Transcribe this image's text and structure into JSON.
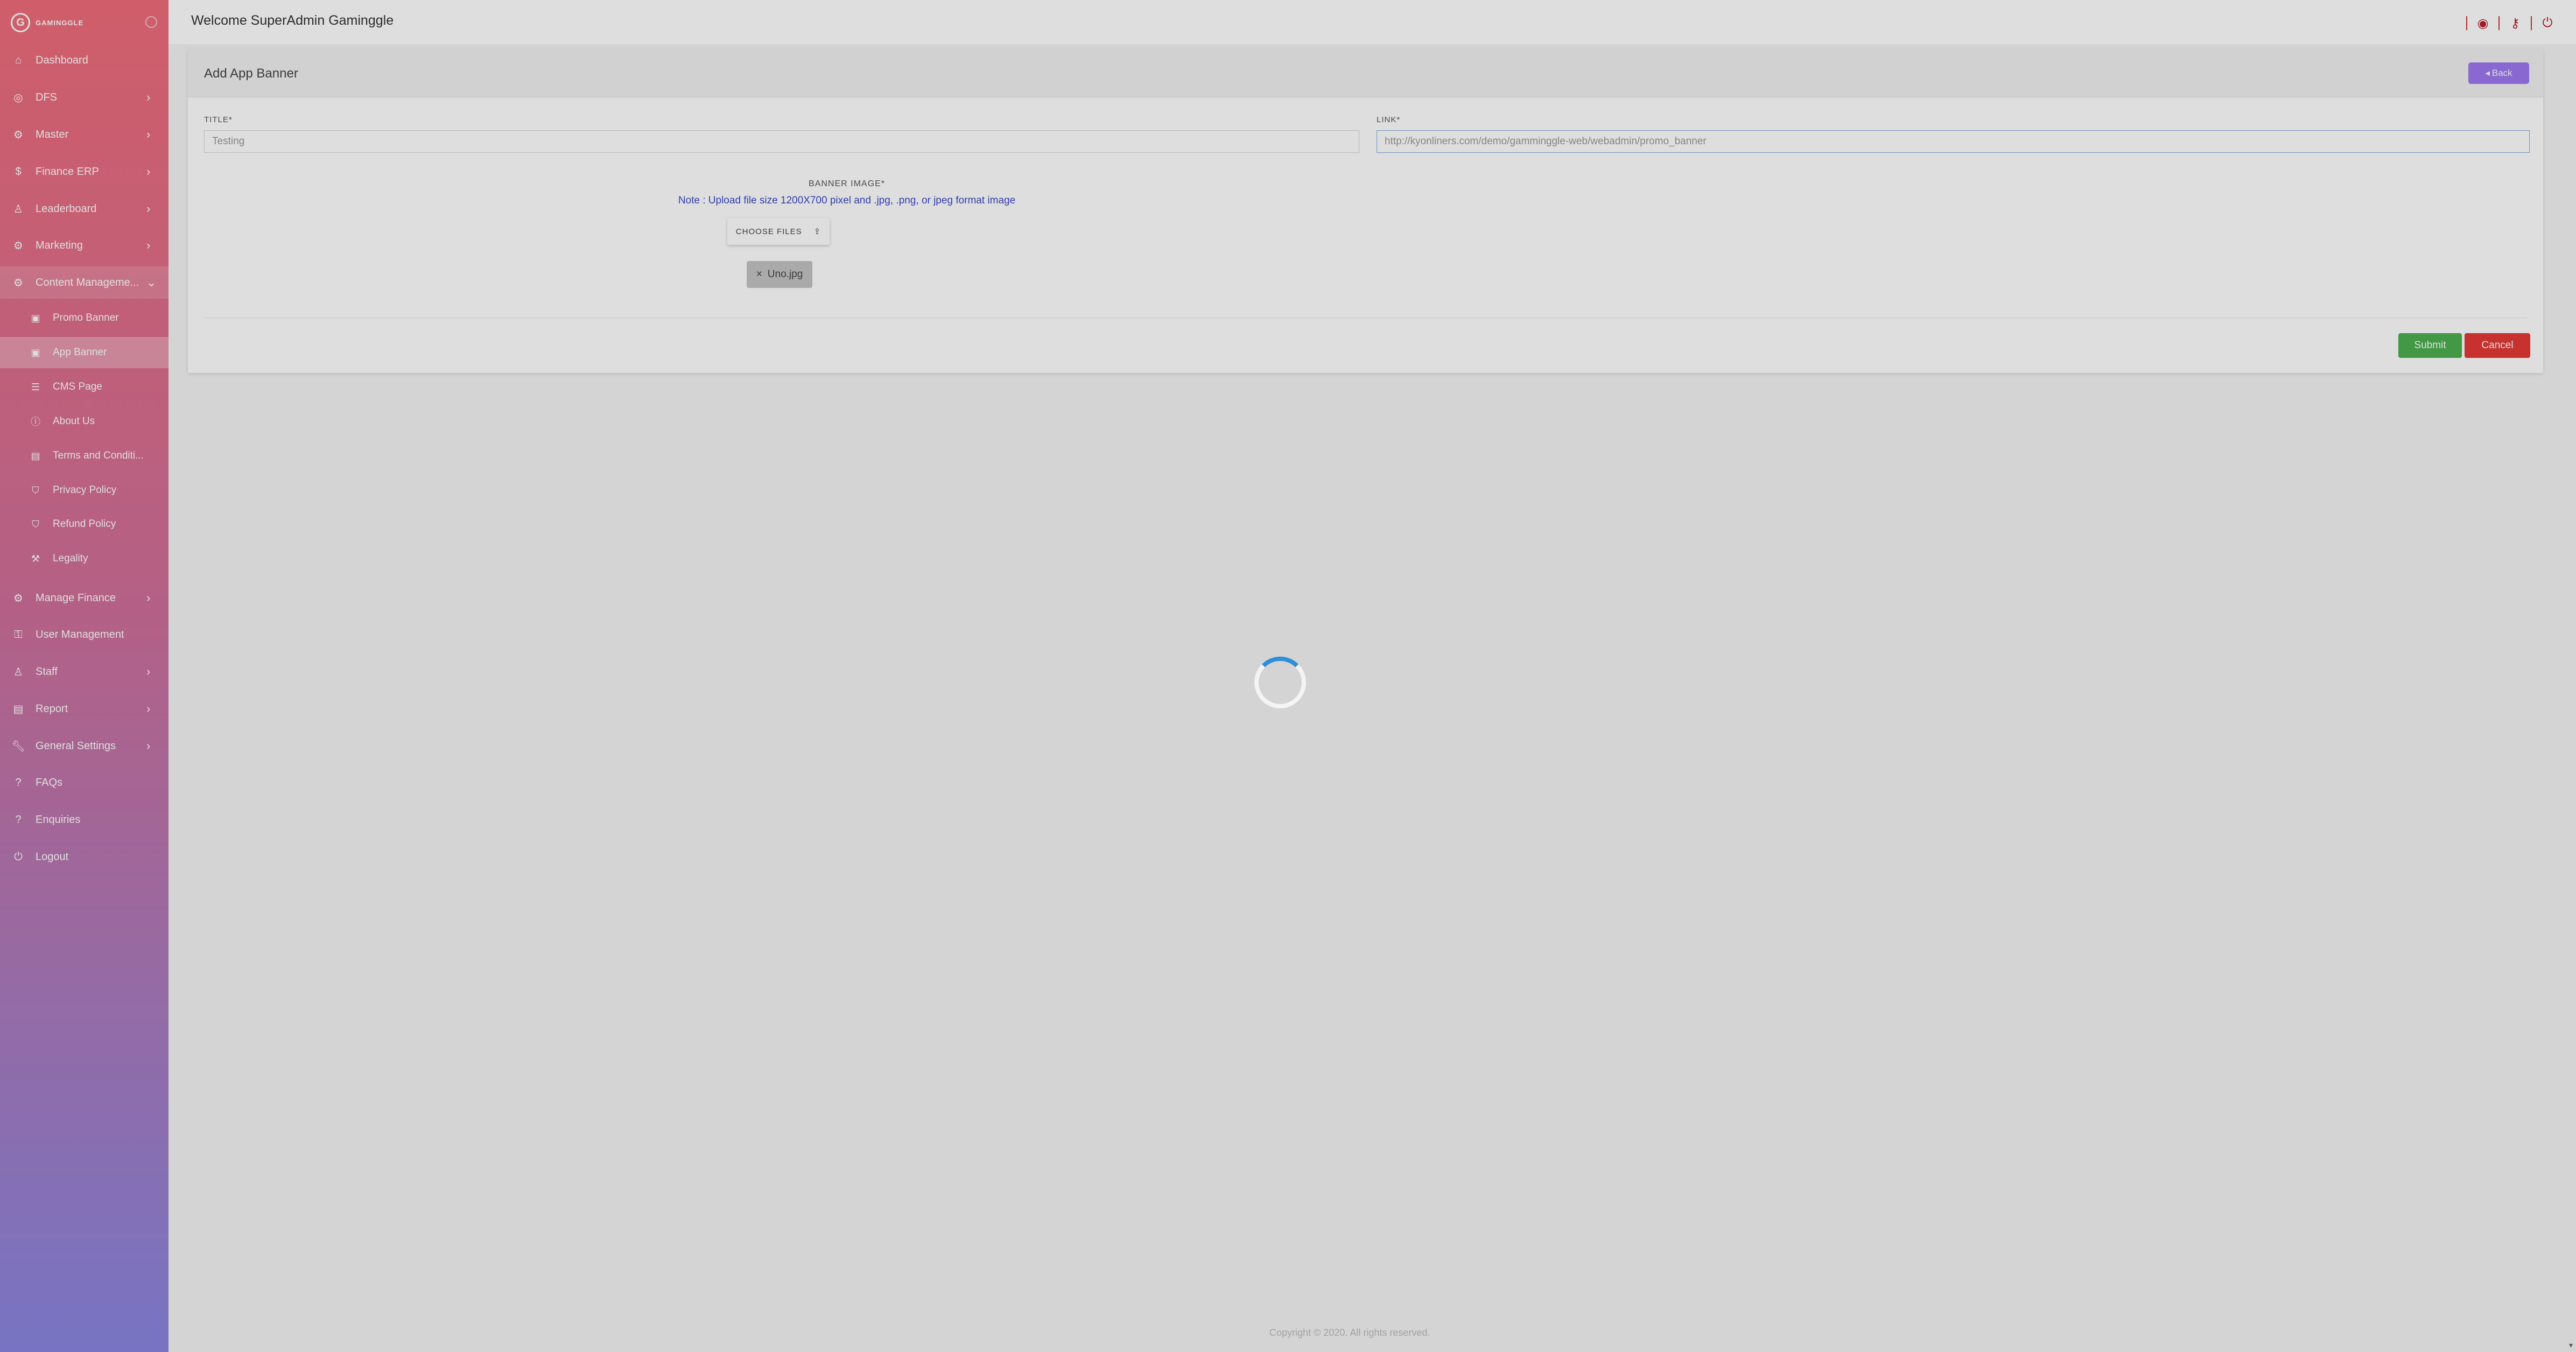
{
  "brand": {
    "logo_glyph": "G",
    "name": "GAMINGGLE"
  },
  "header": {
    "welcome": "Welcome SuperAdmin Gaminggle"
  },
  "sidebar": {
    "items": [
      {
        "label": "Dashboard",
        "icon": "home-icon"
      },
      {
        "label": "DFS",
        "icon": "target-icon",
        "chevron": "›"
      },
      {
        "label": "Master",
        "icon": "gears-icon",
        "chevron": "›"
      },
      {
        "label": "Finance ERP",
        "icon": "dollar-icon",
        "chevron": "›"
      },
      {
        "label": "Leaderboard",
        "icon": "user-icon",
        "chevron": "›"
      },
      {
        "label": "Marketing",
        "icon": "gears-icon",
        "chevron": "›"
      },
      {
        "label": "Content Manageme...",
        "icon": "gears-icon",
        "chevron": "⌄"
      },
      {
        "label": "Manage Finance",
        "icon": "gears-icon",
        "chevron": "›"
      },
      {
        "label": "User Management",
        "icon": "lock-icon"
      },
      {
        "label": "Staff",
        "icon": "user-icon",
        "chevron": "›"
      },
      {
        "label": "Report",
        "icon": "document-icon",
        "chevron": "›"
      },
      {
        "label": "General Settings",
        "icon": "wrench-icon",
        "chevron": "›"
      },
      {
        "label": "FAQs",
        "icon": "question-icon"
      },
      {
        "label": "Enquiries",
        "icon": "question-icon"
      },
      {
        "label": "Logout",
        "icon": "power-icon"
      }
    ],
    "sub_items": [
      {
        "label": "Promo Banner",
        "icon": "image-icon"
      },
      {
        "label": "App Banner",
        "icon": "image-icon"
      },
      {
        "label": "CMS Page",
        "icon": "list-icon"
      },
      {
        "label": "About Us",
        "icon": "info-icon"
      },
      {
        "label": "Terms and Conditi...",
        "icon": "document-icon"
      },
      {
        "label": "Privacy Policy",
        "icon": "shield-icon"
      },
      {
        "label": "Refund Policy",
        "icon": "shield-icon"
      },
      {
        "label": "Legality",
        "icon": "gavel-icon"
      }
    ]
  },
  "form": {
    "title": "Add App Banner",
    "back_label": "Back",
    "title_label": "TITLE*",
    "title_value": "Testing",
    "link_label": "LINK*",
    "link_value": "http://kyonliners.com/demo/gamminggle-web/webadmin/promo_banner",
    "banner_label": "BANNER IMAGE*",
    "note": "Note : Upload file size 1200X700 pixel and .jpg, .png, or jpeg format image",
    "choose_label": "CHOOSE FILES",
    "file_name": "Uno.jpg",
    "file_remove": "×",
    "submit_label": "Submit",
    "cancel_label": "Cancel"
  },
  "footer": {
    "copyright": "Copyright © 2020. All rights reserved."
  },
  "colors": {
    "accent": "#9e78f0",
    "submit": "#4caf50",
    "cancel": "#e53935",
    "header_icons": "#b9202a"
  }
}
